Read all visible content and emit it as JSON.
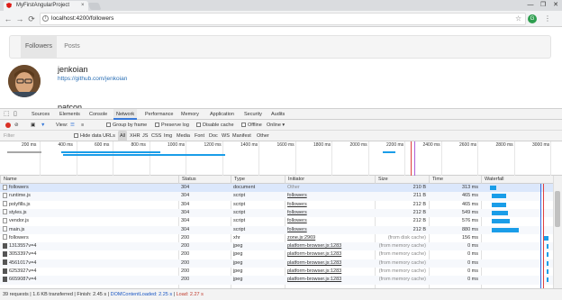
{
  "browser": {
    "tab_title": "MyFirstAngularProject",
    "tab_close": "×",
    "url": "localhost:4200/followers",
    "window_buttons": [
      "—",
      "❐",
      "✕"
    ],
    "nav_icons": [
      "←",
      "→",
      "⟳"
    ],
    "menu_icon": "⋮",
    "star_icon": "☆",
    "ext_label": "G"
  },
  "page": {
    "nav": [
      {
        "label": "Followers",
        "active": true
      },
      {
        "label": "Posts",
        "active": false
      }
    ],
    "followers": [
      {
        "name": "jenkoian",
        "url": "https://github.com/jenkoian"
      },
      {
        "name": "patcon"
      }
    ]
  },
  "devtools": {
    "tabs": [
      "Sources",
      "Elements",
      "Console",
      "Network",
      "Performance",
      "Memory",
      "Application",
      "Security",
      "Audits"
    ],
    "active_tab": "Network",
    "toolbar": {
      "view_label": "View:",
      "group_by_frame": "Group by frame",
      "preserve_log": "Preserve log",
      "disable_cache": "Disable cache",
      "offline": "Offline",
      "throttle": "Online"
    },
    "filterbar": {
      "filter_placeholder": "Filter",
      "hide_data_urls": "Hide data URLs",
      "types": [
        "All",
        "XHR",
        "JS",
        "CSS",
        "Img",
        "Media",
        "Font",
        "Doc",
        "WS",
        "Manifest",
        "Other"
      ]
    },
    "overview_ticks": [
      "200 ms",
      "400 ms",
      "600 ms",
      "800 ms",
      "1000 ms",
      "1200 ms",
      "1400 ms",
      "1600 ms",
      "1800 ms",
      "2000 ms",
      "2200 ms",
      "2400 ms",
      "2600 ms",
      "2800 ms",
      "3000 ms"
    ],
    "columns": [
      "Name",
      "Status",
      "Type",
      "Initiator",
      "Size",
      "Time",
      "Waterfall"
    ],
    "rows": [
      {
        "name": "followers",
        "status": "304",
        "type": "document",
        "initiator": "Other",
        "size": "210 B",
        "time": "313 ms",
        "wf_start": 0.05,
        "wf_len": 0.1,
        "icon": "doc"
      },
      {
        "name": "runtime.js",
        "status": "304",
        "type": "script",
        "initiator": "followers",
        "size": "211 B",
        "time": "465 ms",
        "wf_start": 0.08,
        "wf_len": 0.22,
        "icon": "doc"
      },
      {
        "name": "polyfills.js",
        "status": "304",
        "type": "script",
        "initiator": "followers",
        "size": "212 B",
        "time": "465 ms",
        "wf_start": 0.08,
        "wf_len": 0.22,
        "icon": "doc"
      },
      {
        "name": "styles.js",
        "status": "304",
        "type": "script",
        "initiator": "followers",
        "size": "212 B",
        "time": "549 ms",
        "wf_start": 0.08,
        "wf_len": 0.26,
        "icon": "doc"
      },
      {
        "name": "vendor.js",
        "status": "304",
        "type": "script",
        "initiator": "followers",
        "size": "212 B",
        "time": "576 ms",
        "wf_start": 0.08,
        "wf_len": 0.28,
        "icon": "doc"
      },
      {
        "name": "main.js",
        "status": "304",
        "type": "script",
        "initiator": "followers",
        "size": "212 B",
        "time": "880 ms",
        "wf_start": 0.08,
        "wf_len": 0.42,
        "icon": "doc"
      },
      {
        "name": "followers",
        "status": "200",
        "type": "xhr",
        "initiator": "zone.js:2969",
        "size": "(from disk cache)",
        "time": "156 ms",
        "wf_start": 0.88,
        "wf_len": 0.08,
        "icon": "doc"
      },
      {
        "name": "1313557v=4",
        "status": "200",
        "type": "jpeg",
        "initiator": "platform-browser.js:1283",
        "size": "(from memory cache)",
        "time": "0 ms",
        "wf_start": 0.93,
        "wf_len": 0.02,
        "icon": "img"
      },
      {
        "name": "3053397v=4",
        "status": "200",
        "type": "jpeg",
        "initiator": "platform-browser.js:1283",
        "size": "(from memory cache)",
        "time": "0 ms",
        "wf_start": 0.93,
        "wf_len": 0.02,
        "icon": "img"
      },
      {
        "name": "4561017v=4",
        "status": "200",
        "type": "jpeg",
        "initiator": "platform-browser.js:1283",
        "size": "(from memory cache)",
        "time": "0 ms",
        "wf_start": 0.93,
        "wf_len": 0.02,
        "icon": "img"
      },
      {
        "name": "6253927v=4",
        "status": "200",
        "type": "jpeg",
        "initiator": "platform-browser.js:1283",
        "size": "(from memory cache)",
        "time": "0 ms",
        "wf_start": 0.93,
        "wf_len": 0.02,
        "icon": "img"
      },
      {
        "name": "6659087v=4",
        "status": "200",
        "type": "jpeg",
        "initiator": "platform-browser.js:1283",
        "size": "(from memory cache)",
        "time": "0 ms",
        "wf_start": 0.93,
        "wf_len": 0.02,
        "icon": "img"
      }
    ],
    "status": {
      "requests": "39 requests",
      "transferred": "1.6 KB transferred",
      "finish": "Finish: 2.45 s",
      "dcl": "DOMContentLoaded: 2.25 s",
      "load": "Load: 2.27 s"
    },
    "colors": {
      "accent": "#3879d9",
      "waterfall_bar": "#1a9de8",
      "dcl_line": "#3b6fe0",
      "load_line": "#e04040"
    }
  }
}
